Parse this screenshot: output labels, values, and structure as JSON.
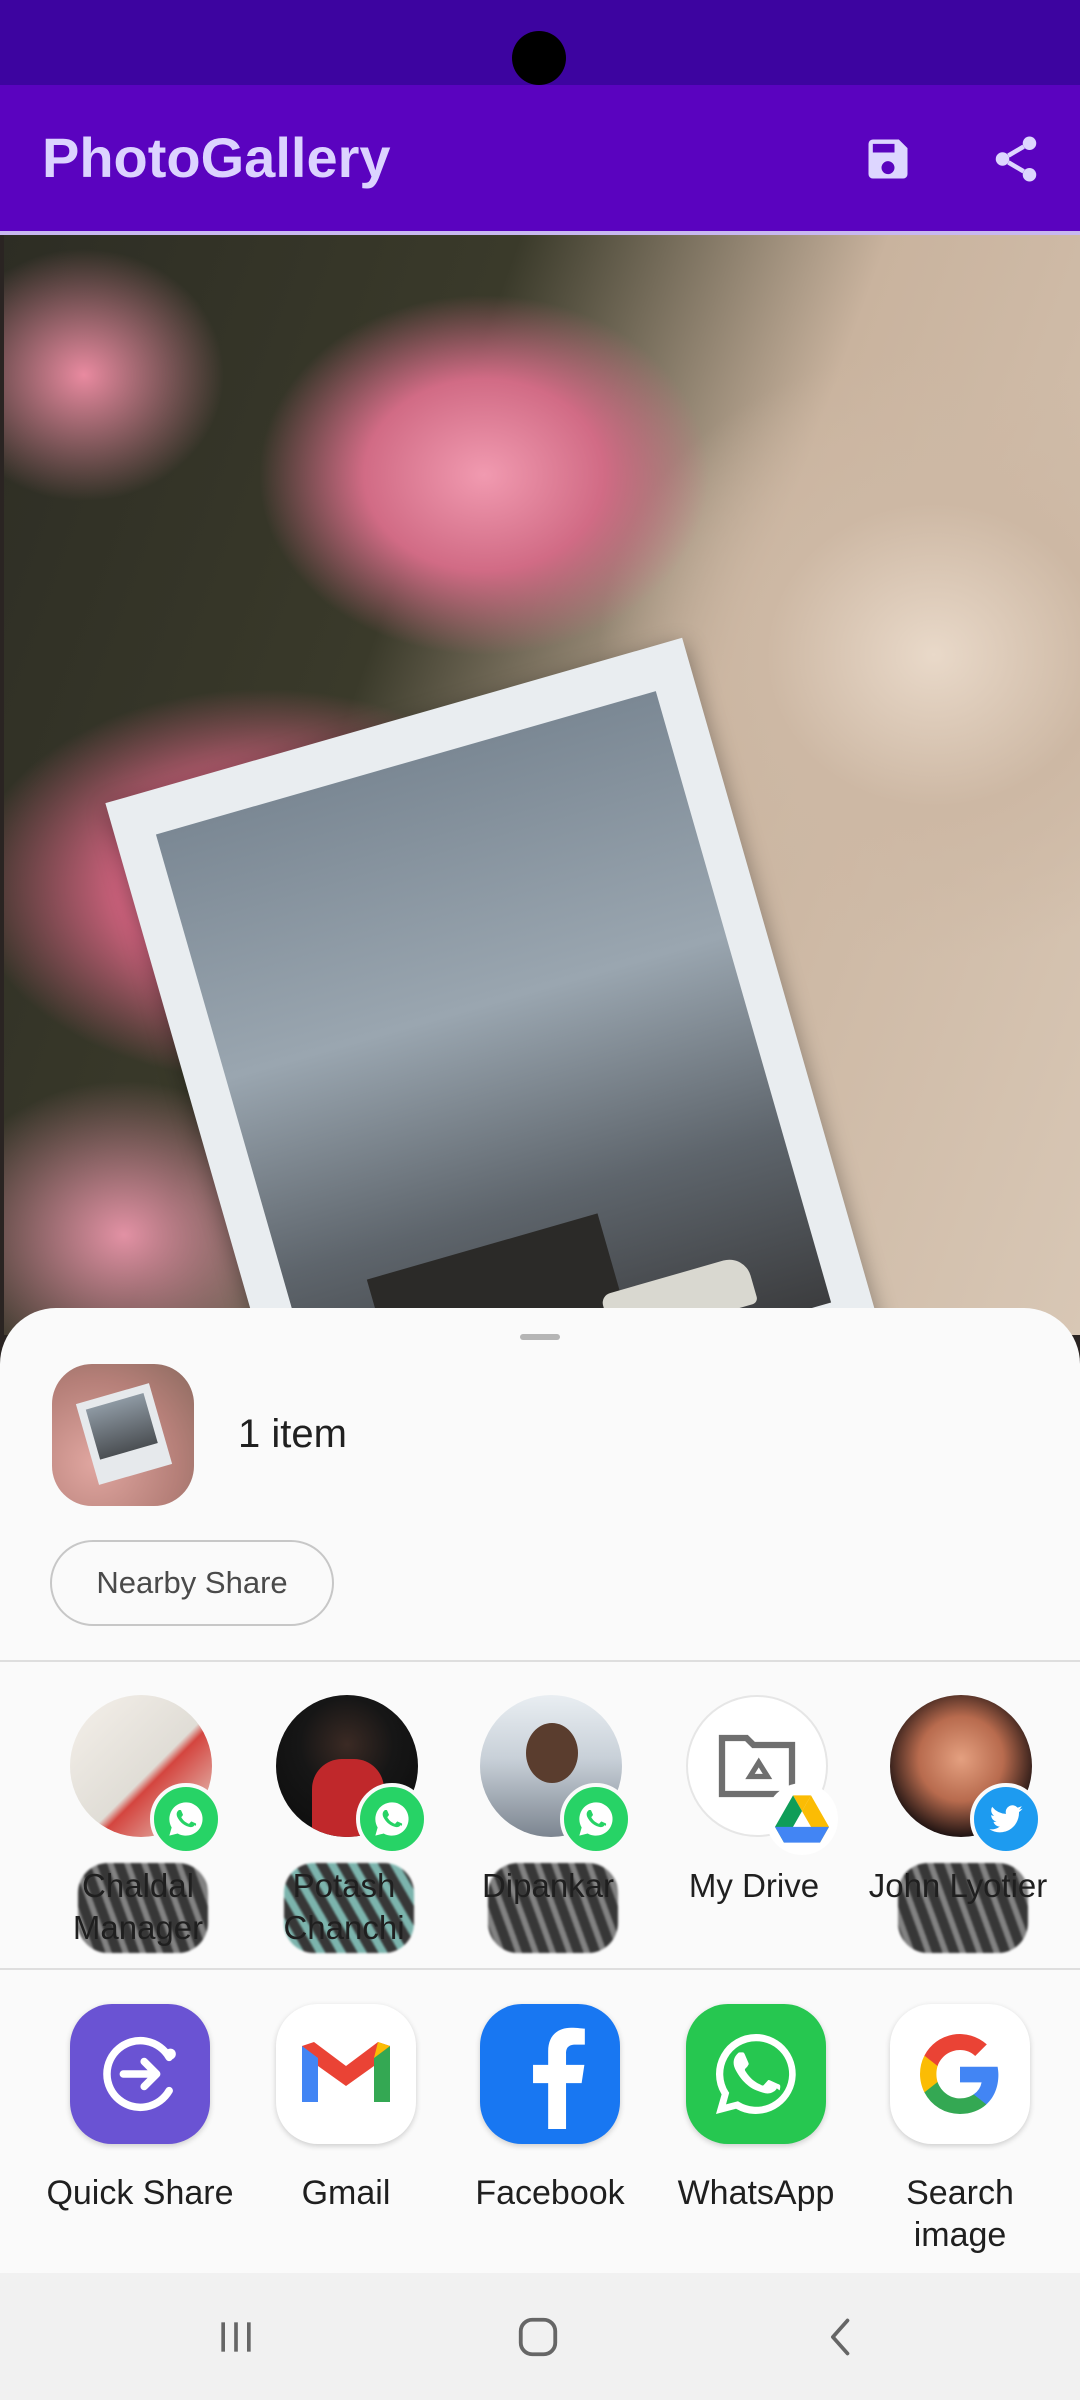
{
  "app_bar": {
    "title": "PhotoGallery",
    "save_icon": "save-icon",
    "share_icon": "share-icon",
    "color": "#5a03bf"
  },
  "share_sheet": {
    "item_count": "1 item",
    "nearby_share": "Nearby Share",
    "direct_targets": [
      {
        "label": "Chaldal Manager",
        "badge": "whatsapp"
      },
      {
        "label": "Potash Chanchi",
        "badge": "whatsapp"
      },
      {
        "label": "Dipankar",
        "badge": "whatsapp"
      },
      {
        "label": "My Drive",
        "badge": "google-drive"
      },
      {
        "label": "John Lyotier",
        "badge": "twitter"
      }
    ],
    "apps": [
      {
        "label": "Quick Share",
        "icon": "quick-share-icon"
      },
      {
        "label": "Gmail",
        "icon": "gmail-icon"
      },
      {
        "label": "Facebook",
        "icon": "facebook-icon"
      },
      {
        "label": "WhatsApp",
        "icon": "whatsapp-icon"
      },
      {
        "label": "Search image",
        "icon": "google-icon"
      }
    ]
  },
  "nav_bar": {
    "recent": "recent-apps-icon",
    "home": "home-icon",
    "back": "back-icon"
  }
}
